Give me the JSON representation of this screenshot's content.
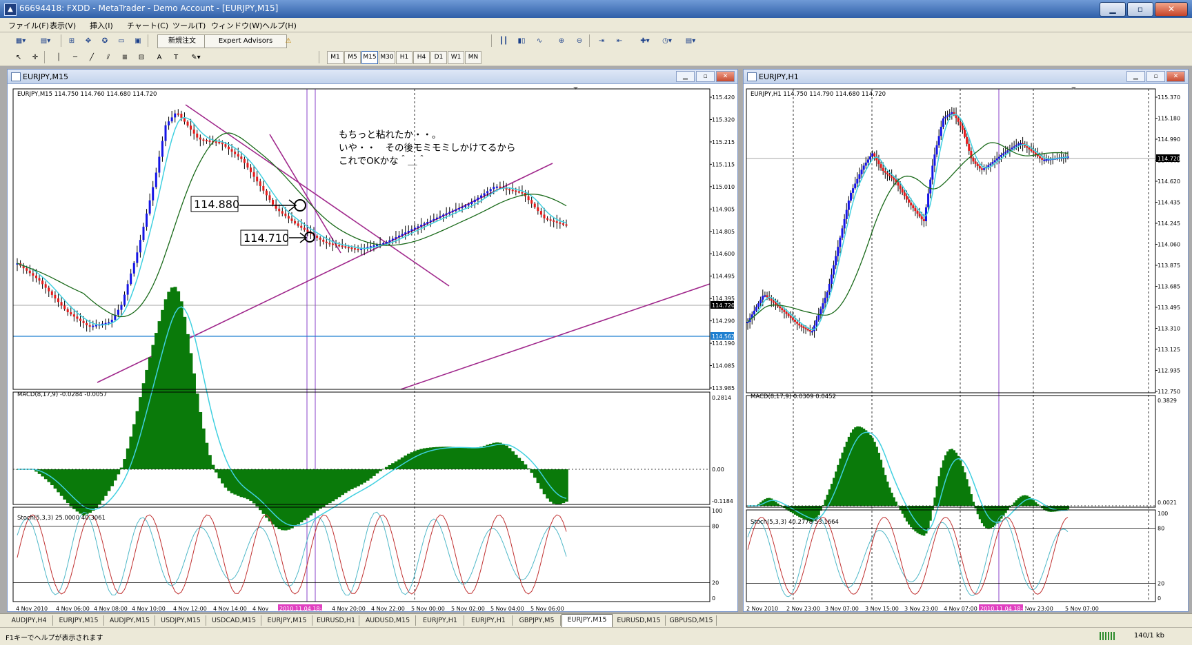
{
  "window": {
    "title": "66694418: FXDD - MetaTrader - Demo Account - [EURJPY,M15]"
  },
  "menu": [
    "ファイル(F)",
    "表示(V)",
    "挿入(I)",
    "チャート(C)",
    "ツール(T)",
    "ウィンドウ(W)",
    "ヘルプ(H)"
  ],
  "toolbar": {
    "new_order": "新規注文",
    "expert_advisors": "Expert Advisors"
  },
  "timeframes": [
    "M1",
    "M5",
    "M15",
    "M30",
    "H1",
    "H4",
    "D1",
    "W1",
    "MN"
  ],
  "timeframe_selected": "M15",
  "left_chart": {
    "window_title": "EURJPY,M15",
    "info": "EURJPY,M15  114.750 114.760 114.680 114.720",
    "price_labels": [
      "115.420",
      "115.320",
      "115.215",
      "115.115",
      "115.010",
      "114.905",
      "114.805",
      "114.600",
      "114.495",
      "114.395",
      "114.290",
      "114.190",
      "114.085",
      "113.985"
    ],
    "current_price": "114.720",
    "hline_price": "114.562",
    "annotation_lines": [
      "もちっと粘れたか・・。",
      "いや・・　その後モミモミしかけてるから",
      "これでOKかな＾＿＾"
    ],
    "label_a": "114.880",
    "label_b": "114.710",
    "macd_info": "MACD(8,17,9) -0.0284 -0.0057",
    "macd_labels": [
      "0.2814",
      "0.00",
      "-0.1184"
    ],
    "stoch_info": "Stoch(5,3,3) 25.0000 40.3061",
    "stoch_labels": [
      "100",
      "80",
      "20",
      "0"
    ],
    "time_labels": [
      "4 Nov 2010",
      "4 Nov 06:00",
      "4 Nov 08:00",
      "4 Nov 10:00",
      "4 Nov 12:00",
      "4 Nov 14:00",
      "4 Nov",
      "4 Nov 20:00",
      "4 Nov 22:00",
      "5 Nov 00:00",
      "5 Nov 02:00",
      "5 Nov 04:00",
      "5 Nov 06:00"
    ],
    "time_highlight": "2010.11.04 18:45"
  },
  "right_chart": {
    "window_title": "EURJPY,H1",
    "info": "EURJPY,H1  114.750 114.790 114.680 114.720",
    "price_labels": [
      "115.370",
      "115.180",
      "114.990",
      "114.805",
      "114.620",
      "114.435",
      "114.245",
      "114.060",
      "113.875",
      "113.685",
      "113.495",
      "113.310",
      "113.125",
      "112.935",
      "112.750"
    ],
    "current_price": "114.720",
    "macd_info": "MACD(8,17,9) 0.0309 0.0452",
    "macd_labels": [
      "0.3829",
      "0.0021"
    ],
    "stoch_info": "Stoch(5,3,3) 40.2778 53.1664",
    "stoch_labels": [
      "100",
      "80",
      "20",
      "0"
    ],
    "time_labels": [
      "2 Nov 2010",
      "2 Nov 23:00",
      "3 Nov 07:00",
      "3 Nov 15:00",
      "3 Nov 23:00",
      "4 Nov 07:00",
      "4 Nov 23:00",
      "5 Nov 07:00"
    ],
    "time_highlight": "2010.11.04 18:00"
  },
  "tabs": [
    "AUDJPY,H4",
    "EURJPY,M15",
    "AUDJPY,M15",
    "USDJPY,M15",
    "USDCAD,M15",
    "EURJPY,M15",
    "EURUSD,H1",
    "AUDUSD,M15",
    "EURJPY,H1",
    "EURJPY,H1",
    "GBPJPY,M5",
    "EURJPY,M15",
    "EURUSD,M15",
    "GBPUSD,M15"
  ],
  "active_tab_index": 11,
  "status": {
    "help": "F1キーでヘルプが表示されます",
    "traffic": "140/1 kb"
  },
  "colors": {
    "bull": "#1414e6",
    "bear": "#e61a1a",
    "ma_fast": "#40d0e0",
    "ma_slow": "#1a6a1a",
    "trend": "#a0288c",
    "macd_hist": "#0a7a0a",
    "hline": "#1e7fd0",
    "vline": "#8a40c8"
  }
}
